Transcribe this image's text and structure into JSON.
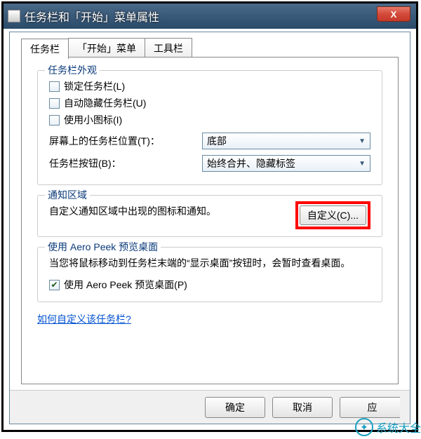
{
  "window": {
    "title": "任务栏和「开始」菜单属性",
    "close": "X"
  },
  "tabs": {
    "taskbar": "任务栏",
    "start": "「开始」菜单",
    "toolbars": "工具栏"
  },
  "appearance": {
    "legend": "任务栏外观",
    "lock": "锁定任务栏(L)",
    "autohide": "自动隐藏任务栏(U)",
    "smallicons": "使用小图标(I)",
    "position_label": "屏幕上的任务栏位置(T)：",
    "position_value": "底部",
    "buttons_label": "任务栏按钮(B)：",
    "buttons_value": "始终合并、隐藏标签"
  },
  "notification": {
    "legend": "通知区域",
    "desc": "自定义通知区域中出现的图标和通知。",
    "customize": "自定义(C)..."
  },
  "aero": {
    "legend": "使用 Aero Peek 预览桌面",
    "desc": "当您将鼠标移动到任务栏末端的“显示桌面”按钮时，会暂时查看桌面。",
    "checkbox": "使用 Aero Peek 预览桌面(P)",
    "checked": true
  },
  "help_link": "如何自定义该任务栏?",
  "buttons": {
    "ok": "确定",
    "cancel": "取消",
    "apply": "应"
  },
  "watermark": "系统大全"
}
